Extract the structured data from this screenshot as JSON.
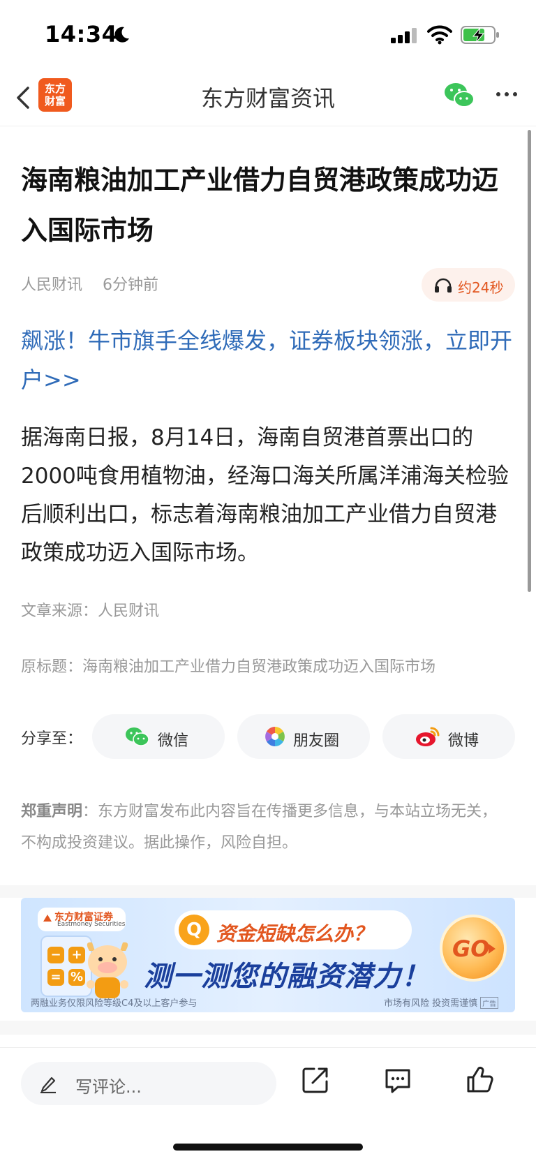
{
  "status_bar": {
    "time": "14:34"
  },
  "nav": {
    "title": "东方财富资讯",
    "logo_line1": "东方",
    "logo_line2": "财富"
  },
  "article": {
    "title": "海南粮油加工产业借力自贸港政策成功迈入国际市场",
    "source": "人民财讯",
    "time_ago": "6分钟前",
    "listen_label": "约24秒",
    "promo_link": "飙涨！牛市旗手全线爆发，证券板块领涨，立即开户>>",
    "body": "据海南日报，8月14日，海南自贸港首票出口的2000吨食用植物油，经海口海关所属洋浦海关检验后顺利出口，标志着海南粮油加工产业借力自贸港政策成功迈入国际市场。",
    "source_line": "文章来源：人民财讯",
    "original_title": "原标题：海南粮油加工产业借力自贸港政策成功迈入国际市场"
  },
  "share": {
    "label": "分享至：",
    "wechat": "微信",
    "moments": "朋友圈",
    "weibo": "微博"
  },
  "disclaimer": {
    "heading": "郑重声明",
    "text": "：东方财富发布此内容旨在传播更多信息，与本站立场无关，不构成投资建议。据此操作，风险自担。"
  },
  "banner": {
    "brand": "东方财富证券",
    "brand_en": "Eastmoney Securities",
    "question_mark": "Q",
    "question": "资金短缺怎么办？",
    "headline": "测一测您的融资潜力！",
    "go": "GO",
    "footnote_left": "两融业务仅限风险等级C4及以上客户参与",
    "footnote_right": "市场有风险 投资需谨慎",
    "ad_tag": "广告",
    "calc_keys": [
      "−",
      "+",
      "=",
      "%"
    ]
  },
  "bottom_bar": {
    "comment_placeholder": "写评论..."
  },
  "colors": {
    "brand": "#f05a1e",
    "link": "#2f6bb8",
    "muted": "#999999"
  }
}
